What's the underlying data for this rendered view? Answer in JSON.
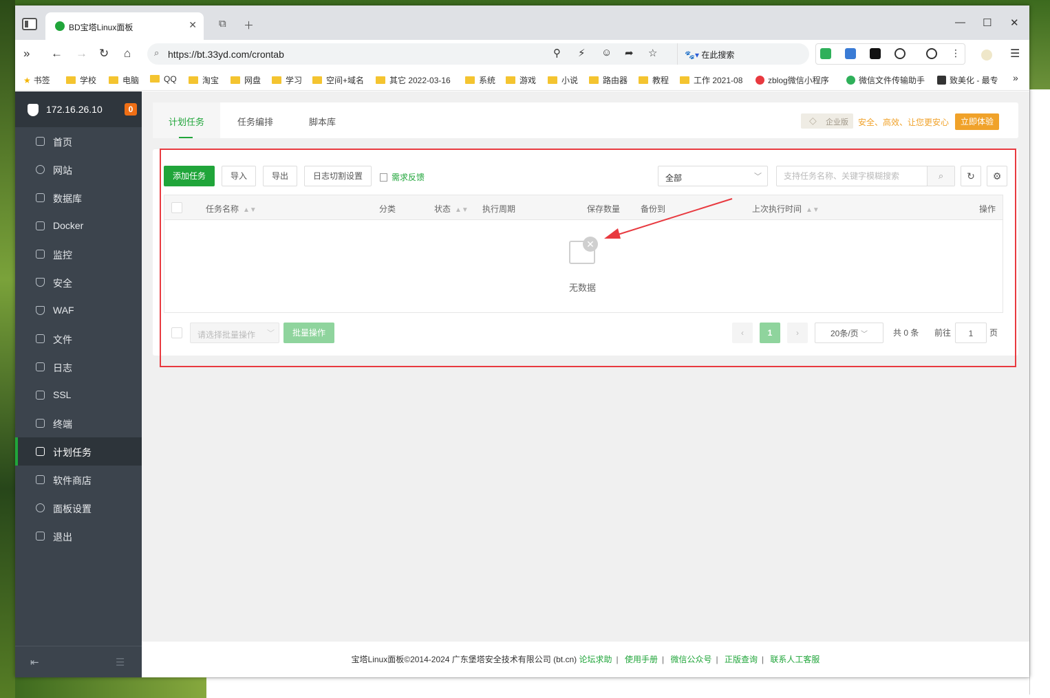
{
  "browser": {
    "tab_title": "BD宝塔Linux面板",
    "url": "https://bt.33yd.com/crontab",
    "search_engine_label": "在此搜索"
  },
  "bookmarks": [
    "书签",
    "学校",
    "电脑",
    "QQ",
    "淘宝",
    "网盘",
    "学习",
    "空间+域名",
    "其它 2022-03-16",
    "系统",
    "游戏",
    "小说",
    "路由器",
    "教程",
    "工作 2021-08",
    "zblog微信小程序",
    "微信文件传输助手",
    "致美化 - 最专"
  ],
  "panel": {
    "ip": "172.16.26.10",
    "notification_count": "0",
    "menu": [
      {
        "label": "首页"
      },
      {
        "label": "网站"
      },
      {
        "label": "数据库"
      },
      {
        "label": "Docker"
      },
      {
        "label": "监控"
      },
      {
        "label": "安全"
      },
      {
        "label": "WAF"
      },
      {
        "label": "文件"
      },
      {
        "label": "日志"
      },
      {
        "label": "SSL"
      },
      {
        "label": "终端"
      },
      {
        "label": "计划任务"
      },
      {
        "label": "软件商店"
      },
      {
        "label": "面板设置"
      },
      {
        "label": "退出"
      }
    ],
    "active_menu": "计划任务"
  },
  "tabs": [
    "计划任务",
    "任务编排",
    "脚本库"
  ],
  "enterprise": {
    "badge": "企业版",
    "slogan": "安全、高效、让您更安心",
    "button": "立即体验"
  },
  "toolbar": {
    "add_task": "添加任务",
    "import": "导入",
    "export": "导出",
    "log_split": "日志切割设置",
    "feedback": "需求反馈",
    "filter_value": "全部",
    "search_placeholder": "支持任务名称、关键字模糊搜索"
  },
  "table": {
    "columns": [
      "任务名称",
      "分类",
      "状态",
      "执行周期",
      "保存数量",
      "备份到",
      "上次执行时间",
      "操作"
    ],
    "empty_text": "无数据"
  },
  "pagination": {
    "batch_placeholder": "请选择批量操作",
    "batch_button": "批量操作",
    "current_page": "1",
    "page_size": "20条/页",
    "total": "共 0 条",
    "goto_label": "前往",
    "goto_value": "1",
    "page_unit": "页"
  },
  "footer": {
    "copyright": "宝塔Linux面板©2014-2024 广东堡塔安全技术有限公司 (bt.cn)",
    "links": [
      "论坛求助",
      "使用手册",
      "微信公众号",
      "正版查询",
      "联系人工客服"
    ]
  },
  "colors": {
    "brand_green": "#20a53a",
    "sidebar_bg": "#3c444d",
    "highlight_red": "#e8393f",
    "enterprise_orange": "#f0a22a"
  }
}
